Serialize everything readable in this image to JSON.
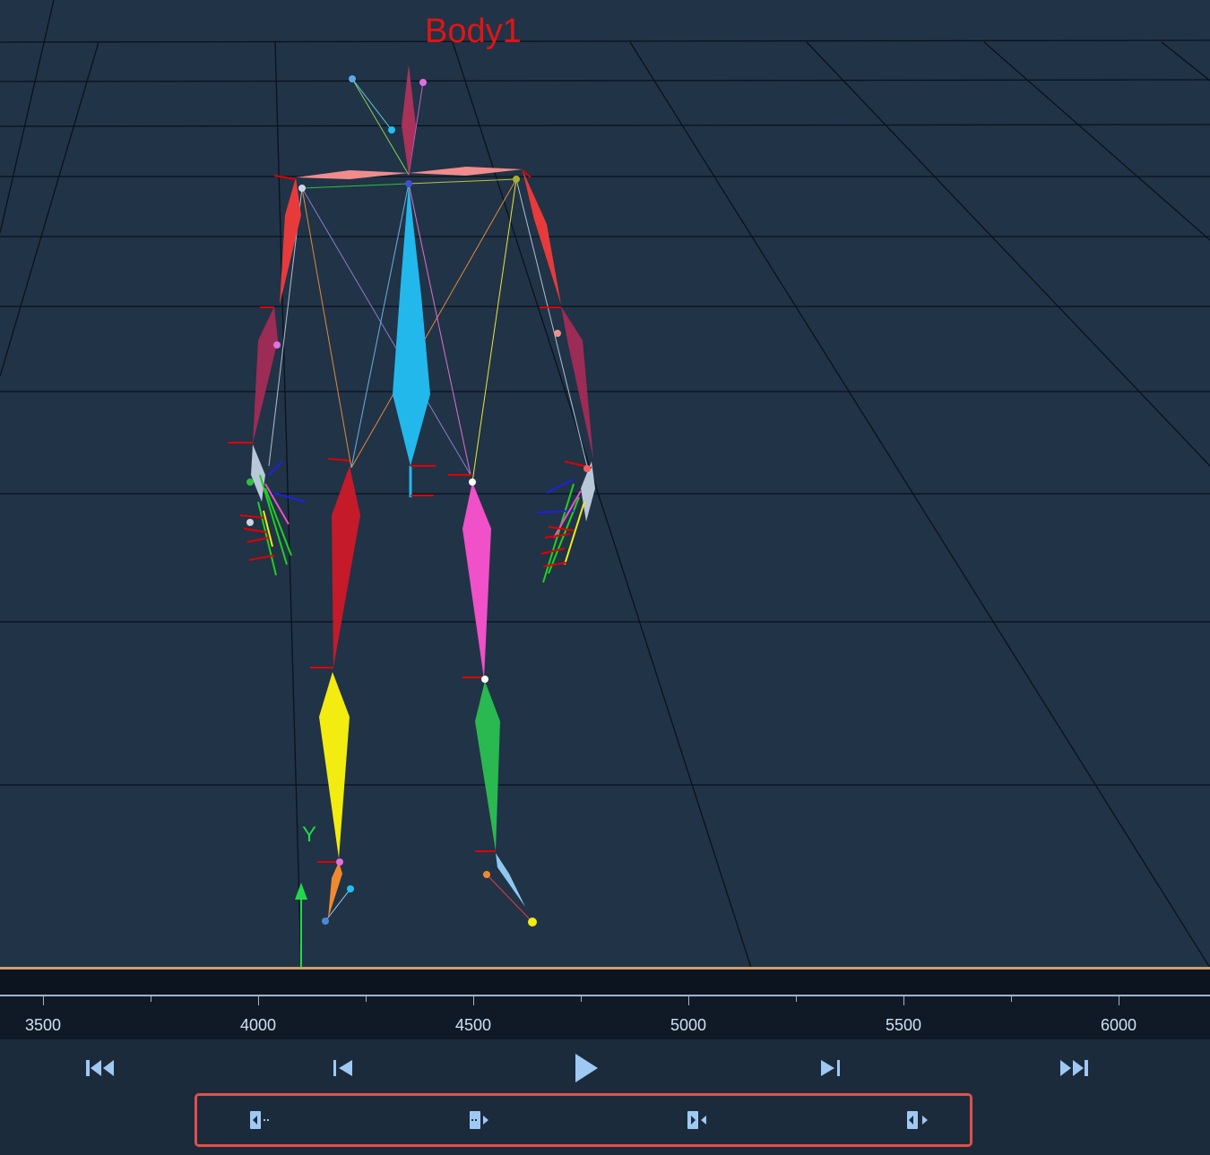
{
  "viewport": {
    "body_label": "Body1",
    "axis_label": "Y",
    "icons": [
      "skeleton-figure",
      "grid-floor",
      "y-axis-arrow"
    ]
  },
  "timeline": {
    "ticks": [
      "3500",
      "4000",
      "4500",
      "5000",
      "5500",
      "6000"
    ]
  },
  "transport": {
    "icons": [
      "skip-to-start-icon",
      "step-back-icon",
      "play-icon",
      "step-forward-icon",
      "skip-to-end-icon"
    ]
  },
  "marks": {
    "icons": [
      "set-in-point-icon",
      "set-out-point-icon",
      "collapse-range-icon",
      "expand-range-icon"
    ]
  },
  "colors": {
    "viewport_bg": "#213347",
    "accent_red": "#e01515",
    "highlight_border": "#e0504a",
    "icon_color": "#9fc9f2"
  }
}
